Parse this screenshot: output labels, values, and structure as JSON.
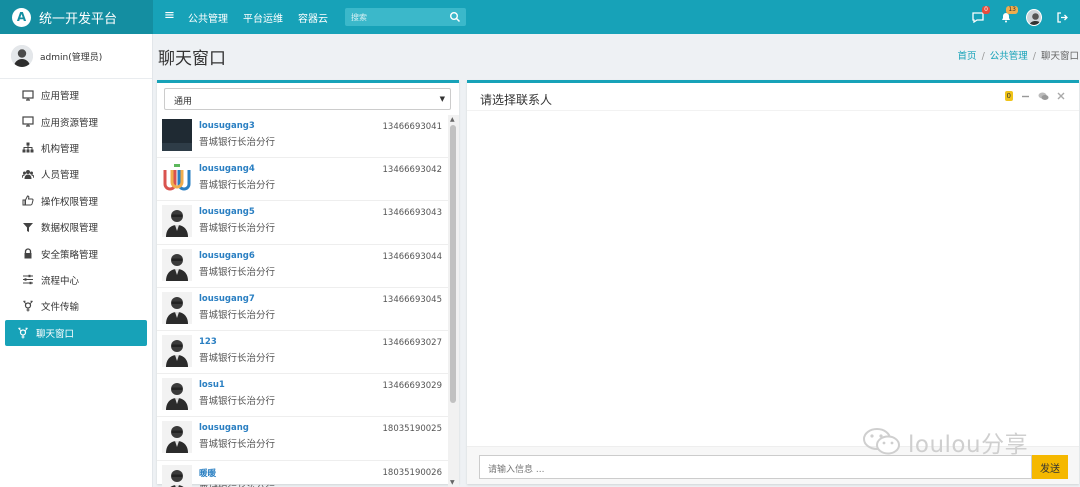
{
  "app": {
    "title": "统一开发平台",
    "logo_letter": "A"
  },
  "topnav": {
    "items": [
      "公共管理",
      "平台运维",
      "容器云"
    ]
  },
  "search": {
    "placeholder": "搜索"
  },
  "top_icons": {
    "messages_badge": "0",
    "notifications_badge": "13"
  },
  "user": {
    "name": "admin(管理员)"
  },
  "sidebar": {
    "items": [
      {
        "label": "应用管理",
        "icon": "monitor-icon"
      },
      {
        "label": "应用资源管理",
        "icon": "monitor-icon"
      },
      {
        "label": "机构管理",
        "icon": "sitemap-icon"
      },
      {
        "label": "人员管理",
        "icon": "users-icon"
      },
      {
        "label": "操作权限管理",
        "icon": "thumb-icon"
      },
      {
        "label": "数据权限管理",
        "icon": "filter-icon"
      },
      {
        "label": "安全策略管理",
        "icon": "lock-icon"
      },
      {
        "label": "流程中心",
        "icon": "sliders-icon"
      },
      {
        "label": "文件传输",
        "icon": "transfer-icon"
      },
      {
        "label": "聊天窗口",
        "icon": "transfer-icon",
        "active": true
      }
    ]
  },
  "page": {
    "title": "聊天窗口"
  },
  "breadcrumb": {
    "home": "首页",
    "section": "公共管理",
    "current": "聊天窗口",
    "sep": "/"
  },
  "contacts_panel": {
    "select_value": "通用",
    "contacts": [
      {
        "name": "lousugang3",
        "org": "晋城银行长治分行",
        "phone": "13466693041",
        "avatar": "dark"
      },
      {
        "name": "lousugang4",
        "org": "晋城银行长治分行",
        "phone": "13466693042",
        "avatar": "logo"
      },
      {
        "name": "lousugang5",
        "org": "晋城银行长治分行",
        "phone": "13466693043",
        "avatar": "person"
      },
      {
        "name": "lousugang6",
        "org": "晋城银行长治分行",
        "phone": "13466693044",
        "avatar": "person"
      },
      {
        "name": "lousugang7",
        "org": "晋城银行长治分行",
        "phone": "13466693045",
        "avatar": "person"
      },
      {
        "name": "123",
        "org": "晋城银行长治分行",
        "phone": "13466693027",
        "avatar": "person"
      },
      {
        "name": "losu1",
        "org": "晋城银行长治分行",
        "phone": "13466693029",
        "avatar": "person"
      },
      {
        "name": "lousugang",
        "org": "晋城银行长治分行",
        "phone": "18035190025",
        "avatar": "person"
      },
      {
        "name": "暖暖",
        "org": "晋城银行长治分行",
        "phone": "18035190026",
        "avatar": "person"
      }
    ]
  },
  "chat_panel": {
    "title": "请选择联系人",
    "badge": "0",
    "input_placeholder": "请输入信息 ...",
    "send_label": "发送"
  },
  "watermark": {
    "text": "loulou分享"
  },
  "colors": {
    "primary": "#17a2b8",
    "send": "#f5b800",
    "link": "#2a7fc2"
  }
}
